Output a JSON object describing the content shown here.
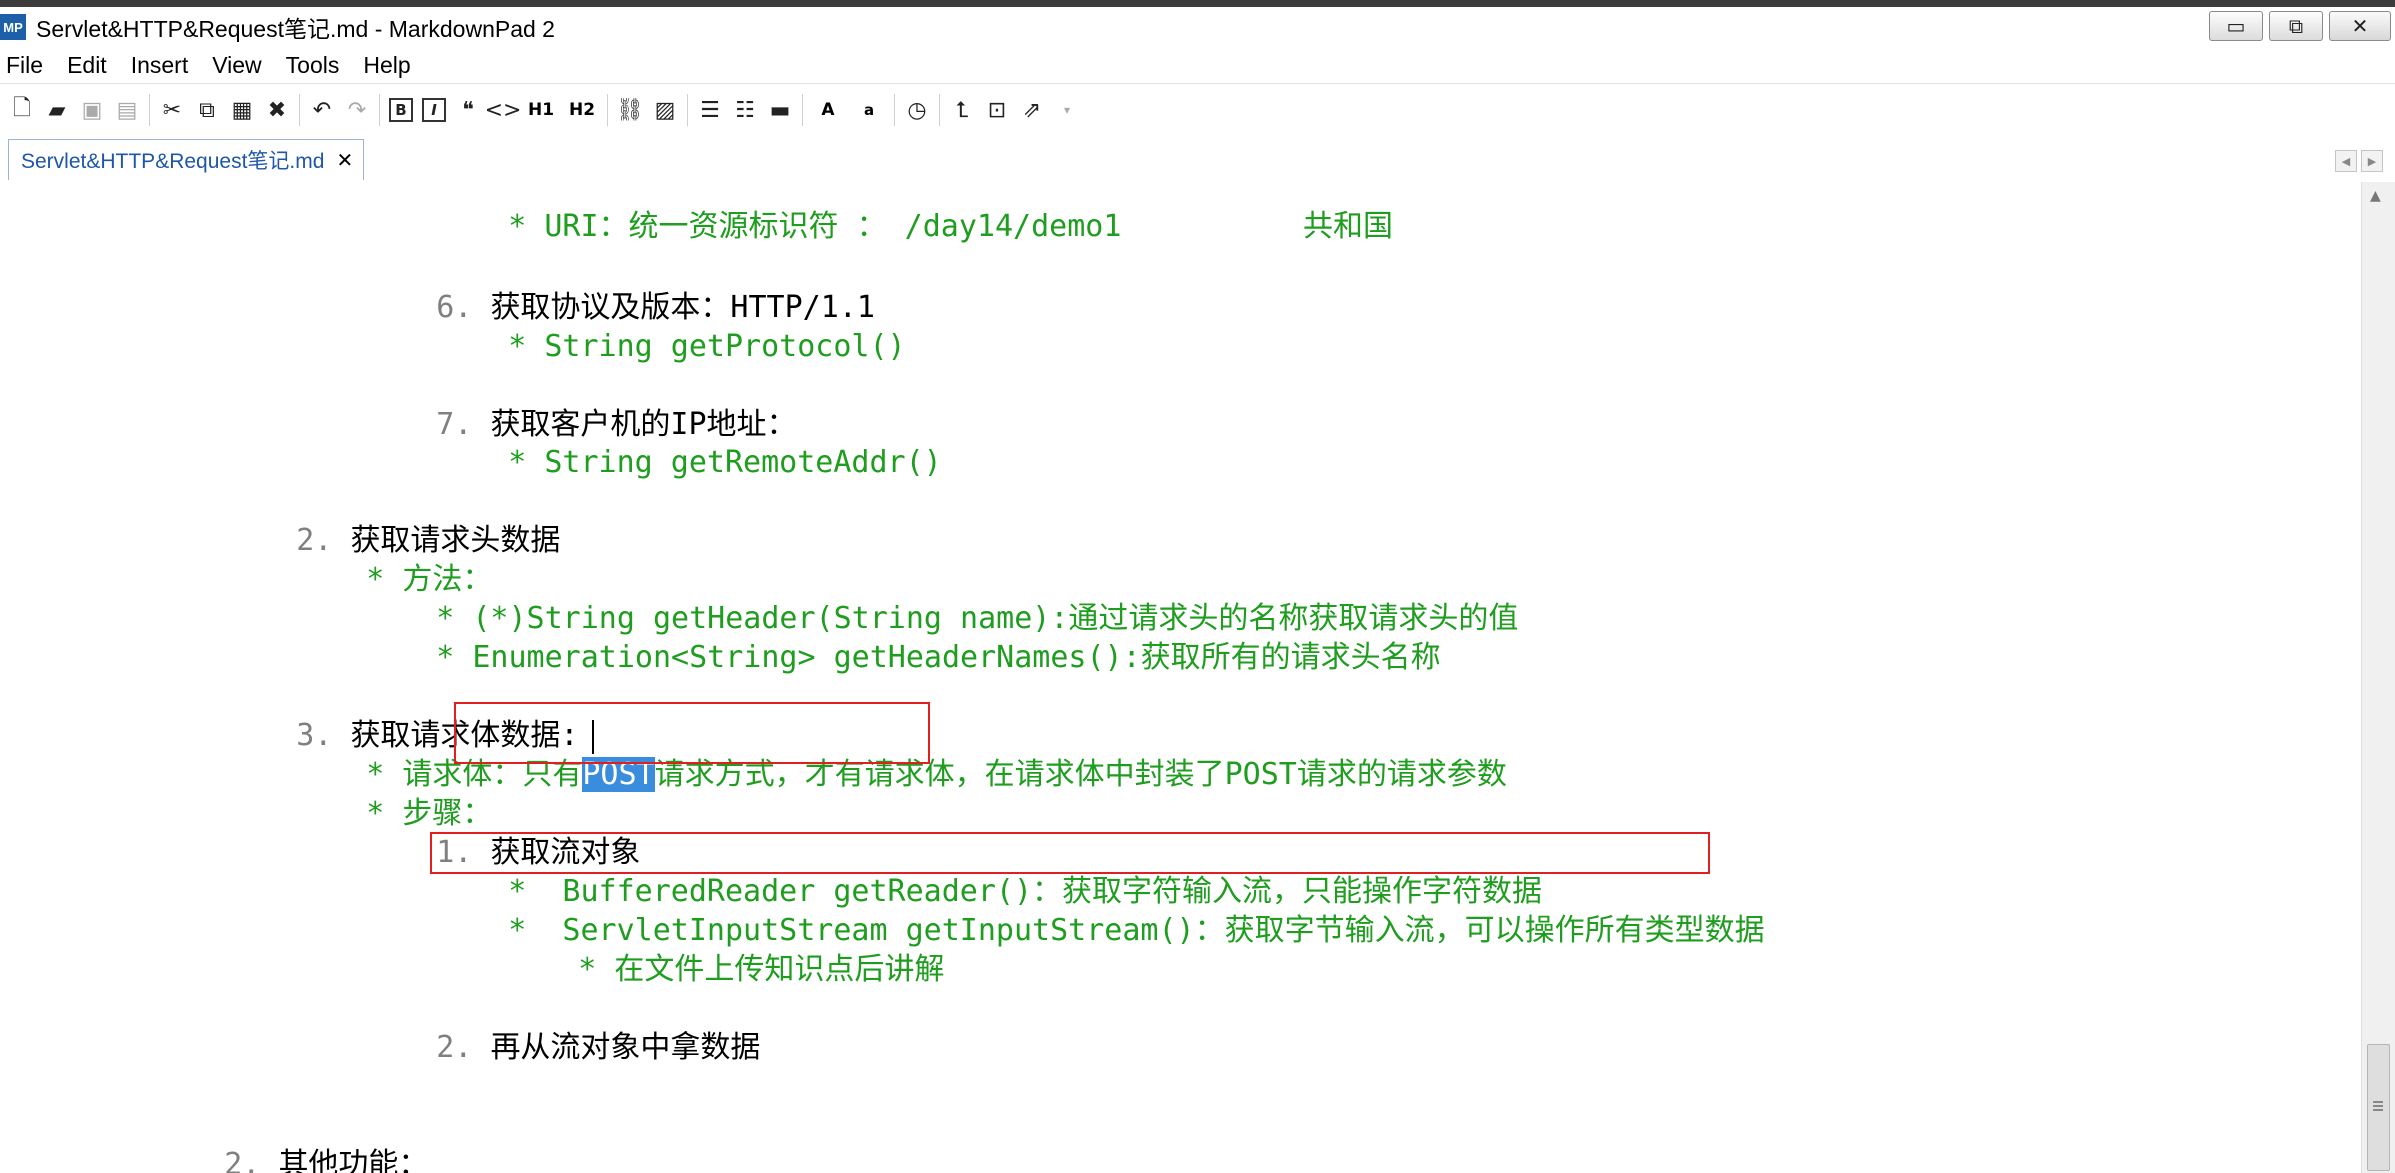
{
  "window": {
    "title": "Servlet&HTTP&Request笔记.md - MarkdownPad 2",
    "app_icon_text": "MP",
    "minimize": "▭",
    "maximize": "⧉",
    "close": "✕"
  },
  "menu": [
    "File",
    "Edit",
    "Insert",
    "View",
    "Tools",
    "Help"
  ],
  "toolbar": {
    "bold": "B",
    "italic": "I",
    "h1": "H1",
    "h2": "H2",
    "font_large": "A",
    "font_small": "a"
  },
  "tab": {
    "label": "Servlet&HTTP&Request笔记.md",
    "close": "✕"
  },
  "editor": {
    "l0": "* URI：统一资源标识符 ： /day14/demo1\t\t共和国",
    "l1_num": "6. ",
    "l1_text": "获取协议及版本：HTTP/1.1",
    "l2": "* String getProtocol()",
    "l3_num": "7. ",
    "l3_text": "获取客户机的IP地址：",
    "l4": "* String getRemoteAddr()",
    "l5_num": "2. ",
    "l5_text": "获取请求头数据",
    "l6": "* 方法：",
    "l7": "* (*)String getHeader(String name):通过请求头的名称获取请求头的值",
    "l8": "* Enumeration<String> getHeaderNames():获取所有的请求头名称",
    "l9_num": "3. ",
    "l9_text": "获取请求体数据:",
    "l10_a": "* 请求体：只有",
    "l10_sel": "POST",
    "l10_b": "请求方式，才有请求体，在请求体中封装了POST请求的请求参数",
    "l11": "* 步骤：",
    "l12_num": "1. ",
    "l12_text": "获取流对象",
    "l13": "*  BufferedReader getReader()：获取字符输入流，只能操作字符数据",
    "l14": "*  ServletInputStream getInputStream()：获取字节输入流，可以操作所有类型数据",
    "l15": "* 在文件上传知识点后讲解",
    "l16_num": "2. ",
    "l16_text": "再从流对象中拿数据",
    "l17_num": "2. ",
    "l17_text": "其他功能："
  }
}
